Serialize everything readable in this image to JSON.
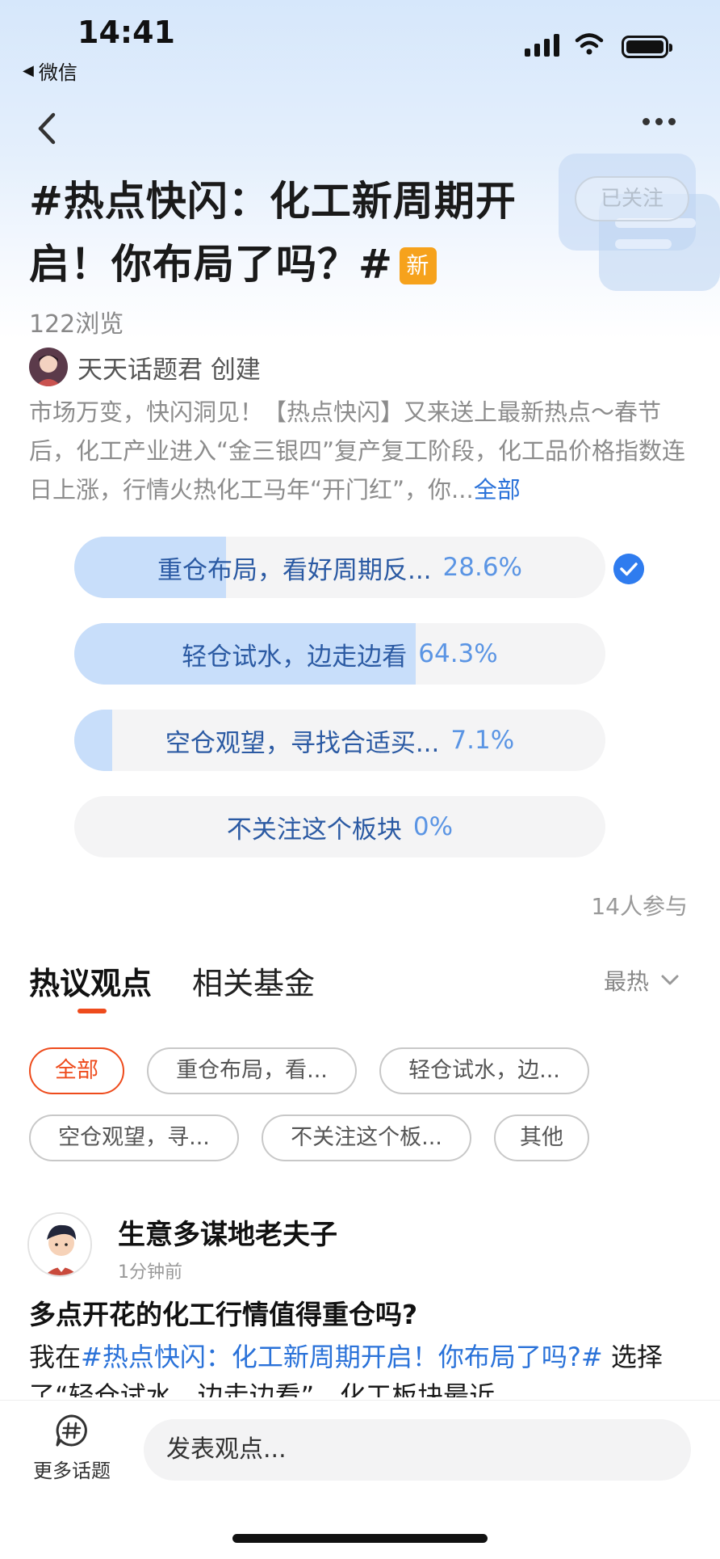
{
  "status_bar": {
    "time": "14:41",
    "back_app": "微信"
  },
  "topic": {
    "title": "#热点快闪：化工新周期开启！你布局了吗？#",
    "new_badge": "新",
    "follow_label": "已关注",
    "views": "122浏览",
    "creator": "天天话题君 创建",
    "description": "市场万变，快闪洞见！【热点快闪】又来送上最新热点～春节后，化工产业进入“金三银四”复产复工阶段，化工品价格指数连日上涨，行情火热化工马年“开门红”，你...",
    "more_label": "全部"
  },
  "poll": {
    "options": [
      {
        "label": "重仓布局，看好周期反...",
        "pct": "28.6%",
        "value": 0.286,
        "selected": true
      },
      {
        "label": "轻仓试水，边走边看",
        "pct": "64.3%",
        "value": 0.643,
        "selected": false
      },
      {
        "label": "空仓观望，寻找合适买...",
        "pct": "7.1%",
        "value": 0.071,
        "selected": false
      },
      {
        "label": "不关注这个板块",
        "pct": "0%",
        "value": 0,
        "selected": false
      }
    ],
    "participants": "14人参与"
  },
  "tabs": {
    "hot": "热议观点",
    "fund": "相关基金",
    "sort": "最热"
  },
  "chips": [
    "全部",
    "重仓布局，看...",
    "轻仓试水，边...",
    "空仓观望，寻...",
    "不关注这个板...",
    "其他"
  ],
  "post": {
    "author": "生意多谋地老夫子",
    "time": "1分钟前",
    "title": "多点开花的化工行情值得重仓吗?",
    "body_prefix": "我在",
    "body_topic": "#热点快闪：化工新周期开启！你布局了吗?#",
    "body_rest": " 选择了“轻仓试水，边走边看”，化工板块最近"
  },
  "bottom_bar": {
    "more_topics": "更多话题",
    "comment_placeholder": "发表观点..."
  },
  "colors": {
    "accent_orange": "#ee4b1c",
    "poll_fill": "#c8defa",
    "link_blue": "#2a72d9",
    "badge_orange": "#f6a21c"
  }
}
